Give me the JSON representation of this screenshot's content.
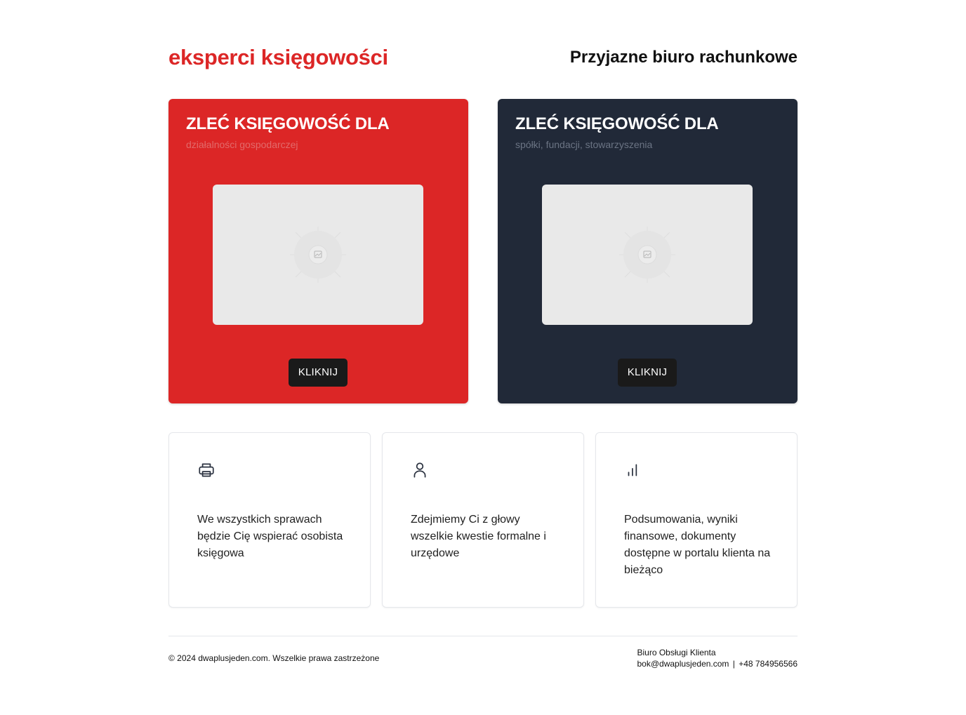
{
  "header": {
    "brand": "eksperci księgowości",
    "tagline": "Przyjazne biuro rachunkowe"
  },
  "hero_cards": [
    {
      "title": "ZLEĆ KSIĘGOWOŚĆ DLA",
      "subtitle": "działalności gospodarczej",
      "button_label": "KLIKNIJ",
      "background": "#dc2626",
      "image_icon": "image-placeholder-icon"
    },
    {
      "title": "ZLEĆ KSIĘGOWOŚĆ DLA",
      "subtitle": "spółki, fundacji, stowarzyszenia",
      "button_label": "KLIKNIJ",
      "background": "#212938",
      "image_icon": "image-placeholder-icon"
    }
  ],
  "features": [
    {
      "icon": "printer-icon",
      "text": "We wszystkich sprawach będzie Cię wspierać osobista księgowa"
    },
    {
      "icon": "user-icon",
      "text": "Zdejmiemy Ci z głowy wszelkie kwestie formalne i urzędowe"
    },
    {
      "icon": "bar-chart-icon",
      "text": "Podsumowania, wyniki finansowe, dokumenty dostępne w portalu klienta na bieżąco"
    }
  ],
  "footer": {
    "copyright": "© 2024 dwaplusjeden.com. Wszelkie prawa zastrzeżone",
    "contact_title": "Biuro Obsługi Klienta",
    "email": "bok@dwaplusjeden.com",
    "separator": "|",
    "phone": "+48 784956566"
  },
  "colors": {
    "accent_red": "#dc2626",
    "navy": "#212938",
    "button_dark": "#1a1a1a"
  }
}
